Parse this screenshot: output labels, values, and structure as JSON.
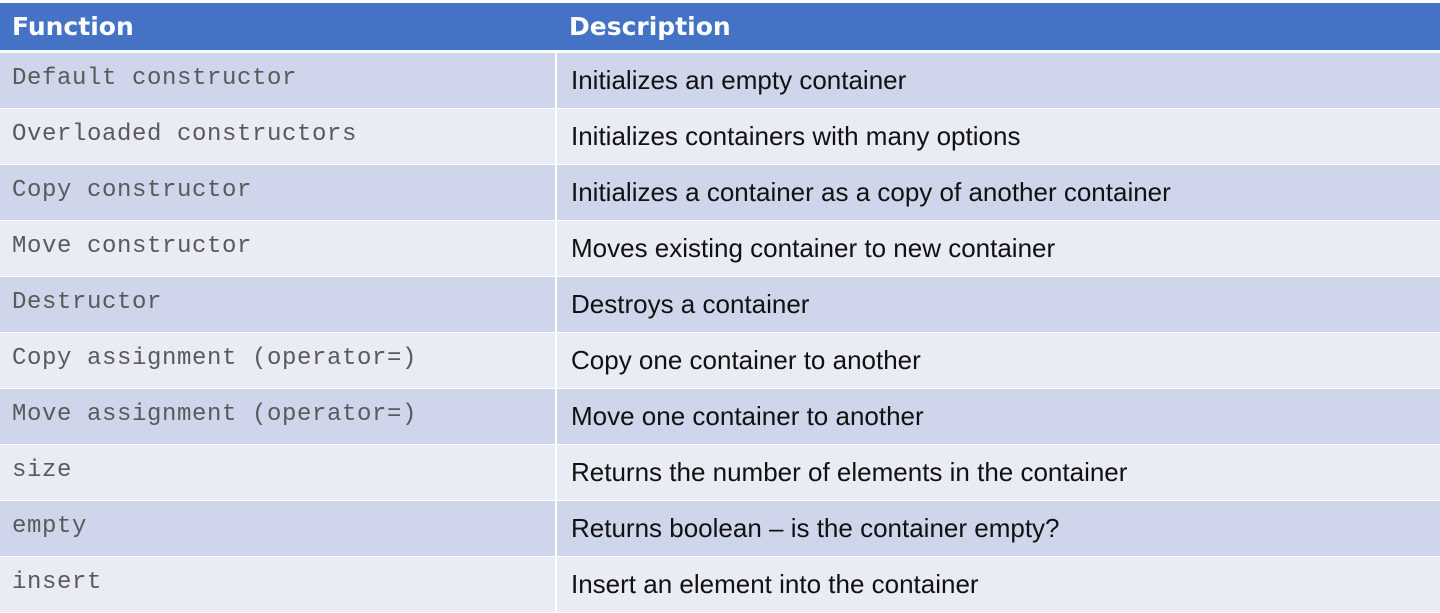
{
  "header": {
    "function": "Function",
    "description": "Description"
  },
  "colors": {
    "header_bg": "#4472c4",
    "row_dark": "#cfd5ea",
    "row_light": "#e9ebf5"
  },
  "rows": [
    {
      "function": "Default constructor",
      "description": "Initializes an empty container"
    },
    {
      "function": "Overloaded constructors",
      "description": "Initializes containers with many options"
    },
    {
      "function": "Copy constructor",
      "description": "Initializes a container as a copy of another container"
    },
    {
      "function": "Move constructor",
      "description": "Moves existing container to new container"
    },
    {
      "function": "Destructor",
      "description": "Destroys a container"
    },
    {
      "function": "Copy assignment (operator=)",
      "description": "Copy one container to another"
    },
    {
      "function": "Move assignment (operator=)",
      "description": "Move one container to another"
    },
    {
      "function": "size",
      "description": "Returns the number of elements in the container"
    },
    {
      "function": "empty",
      "description": "Returns boolean – is the container empty?"
    },
    {
      "function": "insert",
      "description": "Insert an element into the container"
    }
  ]
}
